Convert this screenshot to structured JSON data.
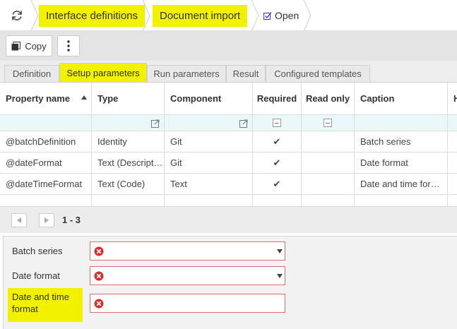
{
  "breadcrumb": {
    "items": [
      "Interface definitions",
      "Document import"
    ],
    "open_label": "Open"
  },
  "toolbar": {
    "copy_label": "Copy"
  },
  "tabs": [
    {
      "label": "Definition",
      "active": false
    },
    {
      "label": "Setup parameters",
      "active": true
    },
    {
      "label": "Run parameters",
      "active": false
    },
    {
      "label": "Result",
      "active": false
    },
    {
      "label": "Configured templates",
      "active": false
    }
  ],
  "grid": {
    "columns": [
      "Property name",
      "Type",
      "Component",
      "Required",
      "Read only",
      "Caption",
      "H"
    ],
    "rows": [
      {
        "property": "@batchDefinition",
        "type": "Identity",
        "component": "Git",
        "required": "✔",
        "read_only": "",
        "caption": "Batch series"
      },
      {
        "property": "@dateFormat",
        "type": "Text (Descript…",
        "component": "Git",
        "required": "✔",
        "read_only": "",
        "caption": "Date format"
      },
      {
        "property": "@dateTimeFormat",
        "type": "Text (Code)",
        "component": "Text",
        "required": "✔",
        "read_only": "",
        "caption": "Date and time for…"
      }
    ]
  },
  "pager": {
    "range": "1 - 3"
  },
  "form": {
    "fields": [
      {
        "label": "Batch series",
        "value": ""
      },
      {
        "label": "Date format",
        "value": ""
      },
      {
        "label": "Date and time format",
        "value": ""
      }
    ]
  },
  "colors": {
    "highlight": "#f2f200",
    "error": "#d32f2f",
    "filter_row": "#eaf7fb"
  }
}
